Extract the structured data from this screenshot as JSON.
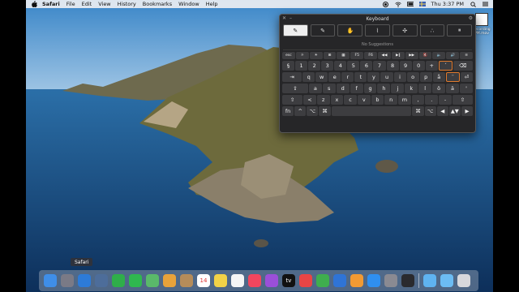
{
  "menubar": {
    "app_name": "Safari",
    "items": [
      "File",
      "Edit",
      "View",
      "History",
      "Bookmarks",
      "Window",
      "Help"
    ],
    "clock": "Thu 3:37 PM"
  },
  "desktop_file": {
    "label_line1": "recording",
    "label_line2": "PM.mov"
  },
  "keyboard": {
    "title": "Keyboard",
    "suggestions_text": "No Suggestions",
    "handwriting_tools": [
      "✎",
      "✎",
      "✋",
      "⌇",
      "✣",
      "∴",
      "⏸"
    ],
    "fn_row": [
      "esc",
      "☼",
      "☀",
      "⊞",
      "▦",
      "F5",
      "F6",
      "◀◀",
      "▶‖",
      "▶▶",
      "🔇",
      "🔈",
      "🔊",
      "≡"
    ],
    "row1": [
      "§",
      "1",
      "2",
      "3",
      "4",
      "5",
      "6",
      "7",
      "8",
      "9",
      "0",
      "+",
      "´",
      "⌫"
    ],
    "row2": [
      "⇥",
      "q",
      "w",
      "e",
      "r",
      "t",
      "y",
      "u",
      "i",
      "o",
      "p",
      "å",
      "¨",
      "⏎"
    ],
    "row3": [
      "⇪",
      "a",
      "s",
      "d",
      "f",
      "g",
      "h",
      "j",
      "k",
      "l",
      "ö",
      "ä",
      "'"
    ],
    "row4": [
      "⇧",
      "<",
      "z",
      "x",
      "c",
      "v",
      "b",
      "n",
      "m",
      ",",
      ".",
      "-",
      "⇧"
    ],
    "row5": [
      "fn",
      "^",
      "⌥",
      "⌘",
      "",
      "⌘",
      "⌥",
      "◀",
      "▲▼",
      "▶"
    ]
  },
  "dock": {
    "tooltip": "Safari",
    "icons": [
      {
        "name": "finder-icon",
        "color": "#3f8ee8"
      },
      {
        "name": "launchpad-icon",
        "color": "#7a7a86"
      },
      {
        "name": "safari-icon",
        "color": "#2d7bd8"
      },
      {
        "name": "preview-icon",
        "color": "#4d6d9a"
      },
      {
        "name": "facetime-icon",
        "color": "#2fae4a"
      },
      {
        "name": "messages-icon",
        "color": "#2fb84f"
      },
      {
        "name": "maps-icon",
        "color": "#5ab96a"
      },
      {
        "name": "photos-icon",
        "color": "#e8a23a"
      },
      {
        "name": "contacts-icon",
        "color": "#b58c5a"
      },
      {
        "name": "calendar-icon",
        "color": "#ffffff",
        "text": "14"
      },
      {
        "name": "notes-icon",
        "color": "#f2d247"
      },
      {
        "name": "reminders-icon",
        "color": "#f5f5f5"
      },
      {
        "name": "music-icon",
        "color": "#f2465e"
      },
      {
        "name": "podcasts-icon",
        "color": "#9b4fd8"
      },
      {
        "name": "tv-icon",
        "color": "#111111",
        "text": "tv"
      },
      {
        "name": "news-icon",
        "color": "#e84545"
      },
      {
        "name": "numbers-icon",
        "color": "#3fae4e"
      },
      {
        "name": "keynote-icon",
        "color": "#2f74d6"
      },
      {
        "name": "pages-icon",
        "color": "#f29a33"
      },
      {
        "name": "app-store-icon",
        "color": "#2f8ff0"
      },
      {
        "name": "system-preferences-icon",
        "color": "#8a8a92"
      },
      {
        "name": "quicktime-icon",
        "color": "#2a2a2e"
      },
      {
        "name": "downloads-folder-icon",
        "color": "#5fb3f0"
      },
      {
        "name": "folder-icon",
        "color": "#6cbcf3"
      },
      {
        "name": "trash-icon",
        "color": "#d8d8dc"
      }
    ]
  }
}
